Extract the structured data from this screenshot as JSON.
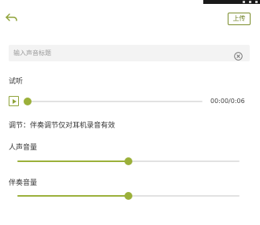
{
  "header": {
    "back_icon": "back-arrow-icon",
    "upload_label": "上传"
  },
  "title_input": {
    "value": "",
    "placeholder": "输入声音标题",
    "clear_icon": "clear-circle-icon"
  },
  "preview": {
    "label": "试听",
    "play_icon": "play-icon",
    "progress": 0,
    "time": "00:00/0:06"
  },
  "adjust": {
    "note": "调节：伴奏调节仅对耳机录音有效",
    "vocal": {
      "label": "人声音量",
      "level": 0.5
    },
    "accompaniment": {
      "label": "伴奏音量",
      "level": 0.5
    }
  },
  "colors": {
    "accent": "#9bb03a",
    "accent_dark": "#6b7d1f",
    "track": "#e2e2e2"
  }
}
